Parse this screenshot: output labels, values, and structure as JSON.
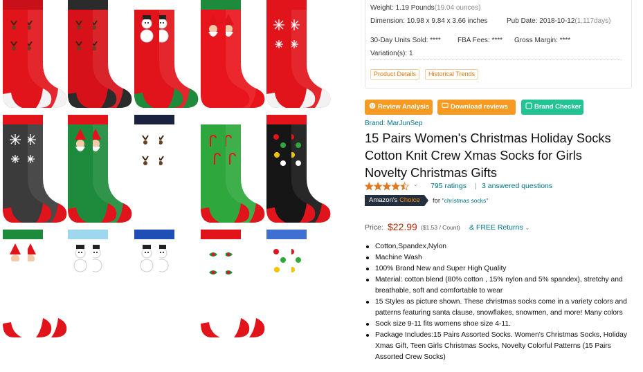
{
  "info": {
    "weight_label": "Weight:",
    "weight_value": "1.19 Pounds",
    "weight_sub": "(19.04 ounces)",
    "dimension_label": "Dimension:",
    "dimension_value": "10.98 x 9.84 x 3.66 inches",
    "pubdate_label": "Pub Date:",
    "pubdate_value": "2018-10-12",
    "pubdate_sub": "(1,117days)",
    "units_label": "30-Day Units Sold:",
    "units_value": "****",
    "fba_label": "FBA Fees:",
    "fba_value": "****",
    "margin_label": "Gross Margin:",
    "margin_value": "****",
    "variation_label": "Variation(s):",
    "variation_value": "1",
    "tab_details": "Product Details",
    "tab_trends": "Historical Trends"
  },
  "actions": {
    "review_analysis": "Review Analysis",
    "download_reviews": "Download reviews",
    "brand_checker": "Brand Checker"
  },
  "product": {
    "brand": "Brand: MarJunSep",
    "title_lines": [
      "15 Pairs Women's Christmas Holiday Socks",
      "Cotton Knit Crew Xmas Socks for Girls",
      "Novelty Christmas Gifts"
    ],
    "rating_stars": 4.5,
    "ratings_text": "795 ratings",
    "answered_text": "3 answered questions",
    "choice_prefix": "Amazon's",
    "choice_suffix": "Choice",
    "choice_for": "for",
    "choice_keyword": "\"christmas socks\"",
    "price_label": "Price:",
    "price_value": "$22.99",
    "price_unit": "($1.53 / Count)",
    "returns": "& FREE Returns",
    "bullets": [
      "Cotton,Spandex,Nylon",
      "Machine Wash",
      "100% Brand New and Super High Quality",
      "Material: cotton blend (80% cotton , 15% nylon and 5% spandex), stretchy and breathable, soft and comfortable to wear",
      "15 Styles as picture shown. These christmas socks come in a variety colors and patterns featuring santa clause, snowflakes, snowmen, and more! Many colors",
      "Sock size 9-11 fits womens shoe size 4-11.",
      "Package Includes:15 Pairs Assorted Socks. Women's Christmas Socks, Holiday Xmas Gift, Teen Girls Christmas Socks, Novelty Colorful Patterns (15 Pairs Assorted Crew Socks)"
    ]
  },
  "colors": {
    "link": "#007185",
    "price": "#b12704",
    "orange_button": "#f59a23",
    "green_button": "#23c395",
    "choice_badge": "#232f3e",
    "star": "#de7921"
  },
  "gallery": {
    "socks": [
      {
        "name": "reindeer-red",
        "body": "#e2141b",
        "cuff": "#c8101a",
        "heel": "#f2f2f2",
        "motif": "antler"
      },
      {
        "name": "reindeer-red-2",
        "body": "#d6111a",
        "cuff": "#2b2b2b",
        "heel": "#2b2b2b",
        "motif": "antler"
      },
      {
        "name": "snowman-red",
        "body": "#e2141b",
        "cuff": "#ffffff",
        "heel": "#1e8b3c",
        "motif": "snowman"
      },
      {
        "name": "sock-it-to-me-santa",
        "body": "#e8161c",
        "cuff": "#1e8b3c",
        "heel": "#e8161c",
        "motif": "santa"
      },
      {
        "name": "snowflake-red",
        "body": "#e2141b",
        "cuff": "#e2141b",
        "heel": "#f2f2f2",
        "motif": "flake"
      },
      {
        "name": "snowflake-grey",
        "body": "#3b3b3b",
        "cuff": "#e2141b",
        "heel": "#e2141b",
        "motif": "flake"
      },
      {
        "name": "santa-diamond",
        "body": "#1e8b3c",
        "cuff": "#e2141b",
        "heel": "#e2141b",
        "motif": "santa"
      },
      {
        "name": "reindeer-navy",
        "body": "#ffffff",
        "cuff": "#1a2240",
        "heel": "#ffffff",
        "motif": "antler"
      },
      {
        "name": "candy-cane-green",
        "body": "#2ea83c",
        "cuff": "#ffffff",
        "heel": "#e2141b",
        "motif": "cane"
      },
      {
        "name": "ornament-black",
        "body": "#161616",
        "cuff": "#e2141b",
        "heel": "#e2141b",
        "motif": "dots"
      },
      {
        "name": "santa-face",
        "body": "#ffffff",
        "cuff": "#1e8b3c",
        "heel": "#e2141b",
        "motif": "santa"
      },
      {
        "name": "snowman-lightblue",
        "body": "#ffffff",
        "cuff": "#9fd8ee",
        "heel": "#ffffff",
        "motif": "snowman"
      },
      {
        "name": "snowman-blue",
        "body": "#ffffff",
        "cuff": "#1f4fb4",
        "heel": "#ffffff",
        "motif": "snowman"
      },
      {
        "name": "holly-white",
        "body": "#ffffff",
        "cuff": "#e2141b",
        "heel": "#e2141b",
        "motif": "holly"
      },
      {
        "name": "santa-blue",
        "body": "#ffffff",
        "cuff": "#3f6fd0",
        "heel": "#ffffff",
        "motif": "dots"
      }
    ]
  }
}
